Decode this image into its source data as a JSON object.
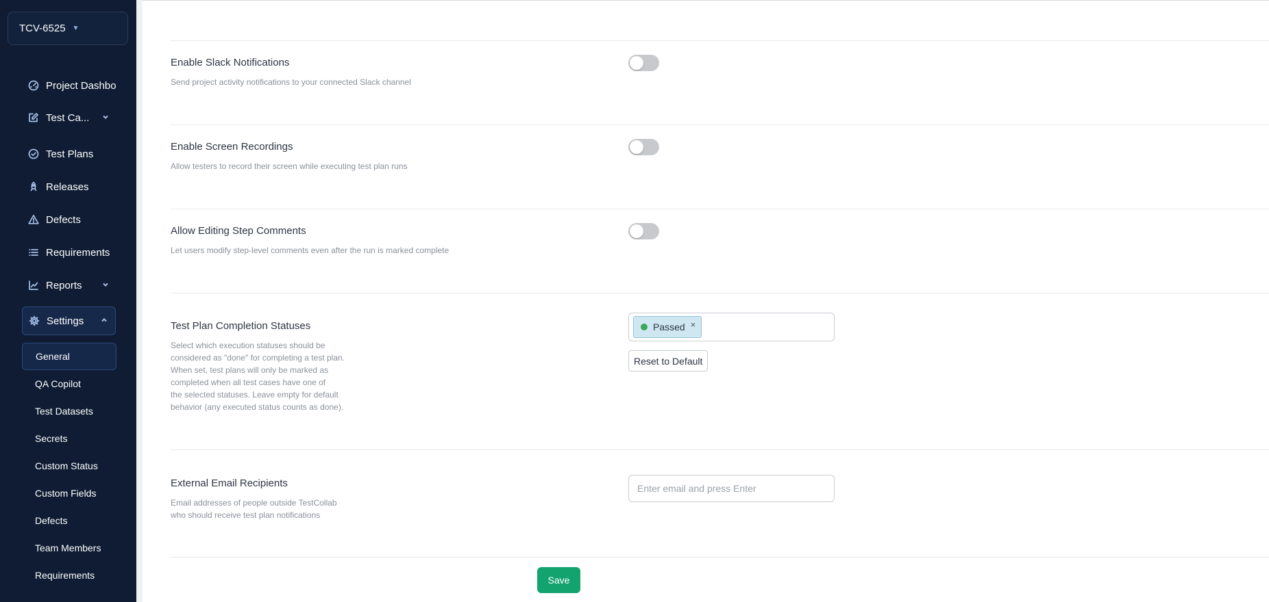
{
  "project": {
    "name": "TCV-6525"
  },
  "nav": {
    "items": [
      {
        "label": "Project Dashboa",
        "icon": "dashboard-icon"
      },
      {
        "label": "Test Ca...",
        "icon": "edit-icon",
        "has_chevron": true
      },
      {
        "label": "Test Plans",
        "icon": "check-circle-icon"
      },
      {
        "label": "Releases",
        "icon": "rocket-icon"
      },
      {
        "label": "Defects",
        "icon": "warning-icon"
      },
      {
        "label": "Requirements",
        "icon": "list-icon"
      },
      {
        "label": "Reports",
        "icon": "chart-icon",
        "has_chevron": true
      },
      {
        "label": "Settings",
        "icon": "gear-icon",
        "expanded": true
      }
    ],
    "settings_sub": [
      "General",
      "QA Copilot",
      "Test Datasets",
      "Secrets",
      "Custom Status",
      "Custom Fields",
      "Defects",
      "Team Members",
      "Requirements"
    ],
    "active_sub": "General"
  },
  "settings": {
    "slack": {
      "title": "Enable Slack Notifications",
      "desc": "Send project activity notifications to your connected Slack channel",
      "enabled": false
    },
    "screen": {
      "title": "Enable Screen Recordings",
      "desc": "Allow testers to record their screen while executing test plan runs",
      "enabled": false
    },
    "step_comments": {
      "title": "Allow Editing Step Comments",
      "desc": "Let users modify step-level comments even after the run is marked complete",
      "enabled": false
    },
    "completion": {
      "title": "Test Plan Completion Statuses",
      "desc_lines": [
        "Select which execution statuses should be",
        "considered as \"done\" for completing a test plan.",
        "When set, test plans will only be marked as",
        "completed when all test cases have one of",
        "the selected statuses. Leave empty for default",
        "behavior (any executed status counts as done)."
      ],
      "selected": [
        {
          "label": "Passed",
          "color": "#3aa85a"
        }
      ],
      "reset_label": "Reset to Default"
    },
    "email": {
      "title": "External Email Recipients",
      "desc_lines": [
        "Email addresses of people outside TestCollab",
        "who should receive test plan notifications"
      ],
      "placeholder": "Enter email and press Enter",
      "value": ""
    },
    "save_label": "Save"
  },
  "colors": {
    "sidebar_bg": "#0f1c33",
    "save_button": "#13a36e",
    "toggle_off": "#c7c9cc",
    "tag_bg": "#cfe7f1"
  }
}
